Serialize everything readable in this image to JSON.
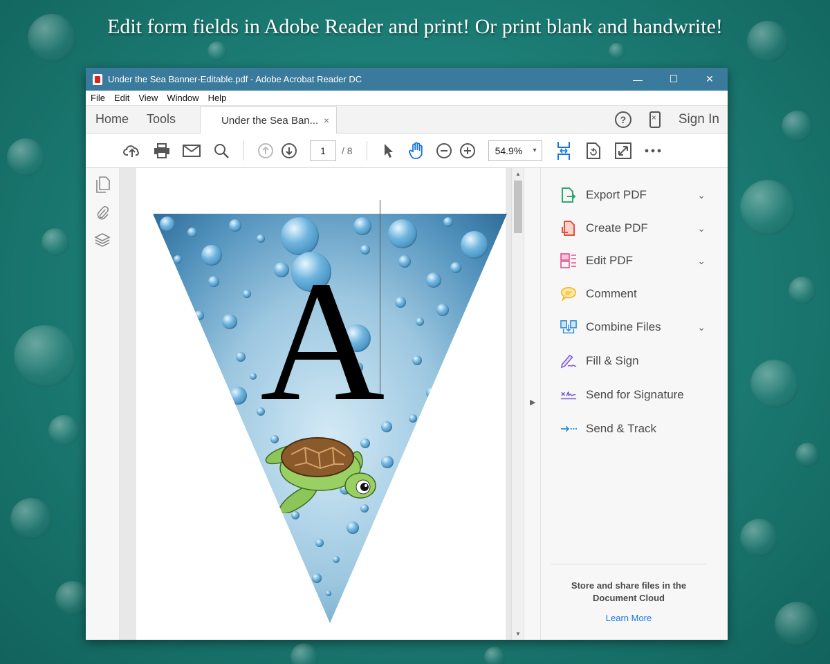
{
  "headline": "Edit form fields in Adobe Reader and print! Or print blank and handwrite!",
  "window": {
    "title": "Under the Sea Banner-Editable.pdf - Adobe Acrobat Reader DC",
    "controls": {
      "minimize": "—",
      "maximize": "☐",
      "close": "✕"
    }
  },
  "menu": [
    "File",
    "Edit",
    "View",
    "Window",
    "Help"
  ],
  "tabs": {
    "home": "Home",
    "tools": "Tools",
    "document": "Under the Sea Ban...",
    "close": "×",
    "help": "?",
    "sign_in": "Sign In"
  },
  "toolbar": {
    "current_page": "1",
    "total_pages": "/ 8",
    "zoom": "54.9%",
    "zoom_caret": "▾",
    "icons": [
      "upload-cloud-icon",
      "print-icon",
      "email-icon",
      "search-icon",
      "prev-page-icon",
      "next-page-icon",
      "select-arrow-icon",
      "hand-icon",
      "zoom-out-icon",
      "zoom-in-icon",
      "scroll-mode-icon",
      "rotate-icon",
      "fullscreen-icon",
      "more-icon"
    ]
  },
  "document": {
    "letter": "A"
  },
  "tools_panel": {
    "items": [
      {
        "label": "Export PDF",
        "chevron": true,
        "color": "#2da771"
      },
      {
        "label": "Create PDF",
        "chevron": true,
        "color": "#e2533e"
      },
      {
        "label": "Edit PDF",
        "chevron": true,
        "color": "#e0508e"
      },
      {
        "label": "Comment",
        "chevron": false,
        "color": "#f2b824"
      },
      {
        "label": "Combine Files",
        "chevron": true,
        "color": "#2b8bd6"
      },
      {
        "label": "Fill & Sign",
        "chevron": false,
        "color": "#7a5cc9"
      },
      {
        "label": "Send for Signature",
        "chevron": false,
        "color": "#7a5cc9"
      },
      {
        "label": "Send & Track",
        "chevron": false,
        "color": "#2b8bd6"
      }
    ],
    "chevron_glyph": "⌄",
    "store_text": "Store and share files in the Document Cloud",
    "learn_more": "Learn More"
  },
  "colors": {
    "titlebar": "#3a7a9c",
    "accent_blue": "#1473e6",
    "background": "#1d8078"
  }
}
